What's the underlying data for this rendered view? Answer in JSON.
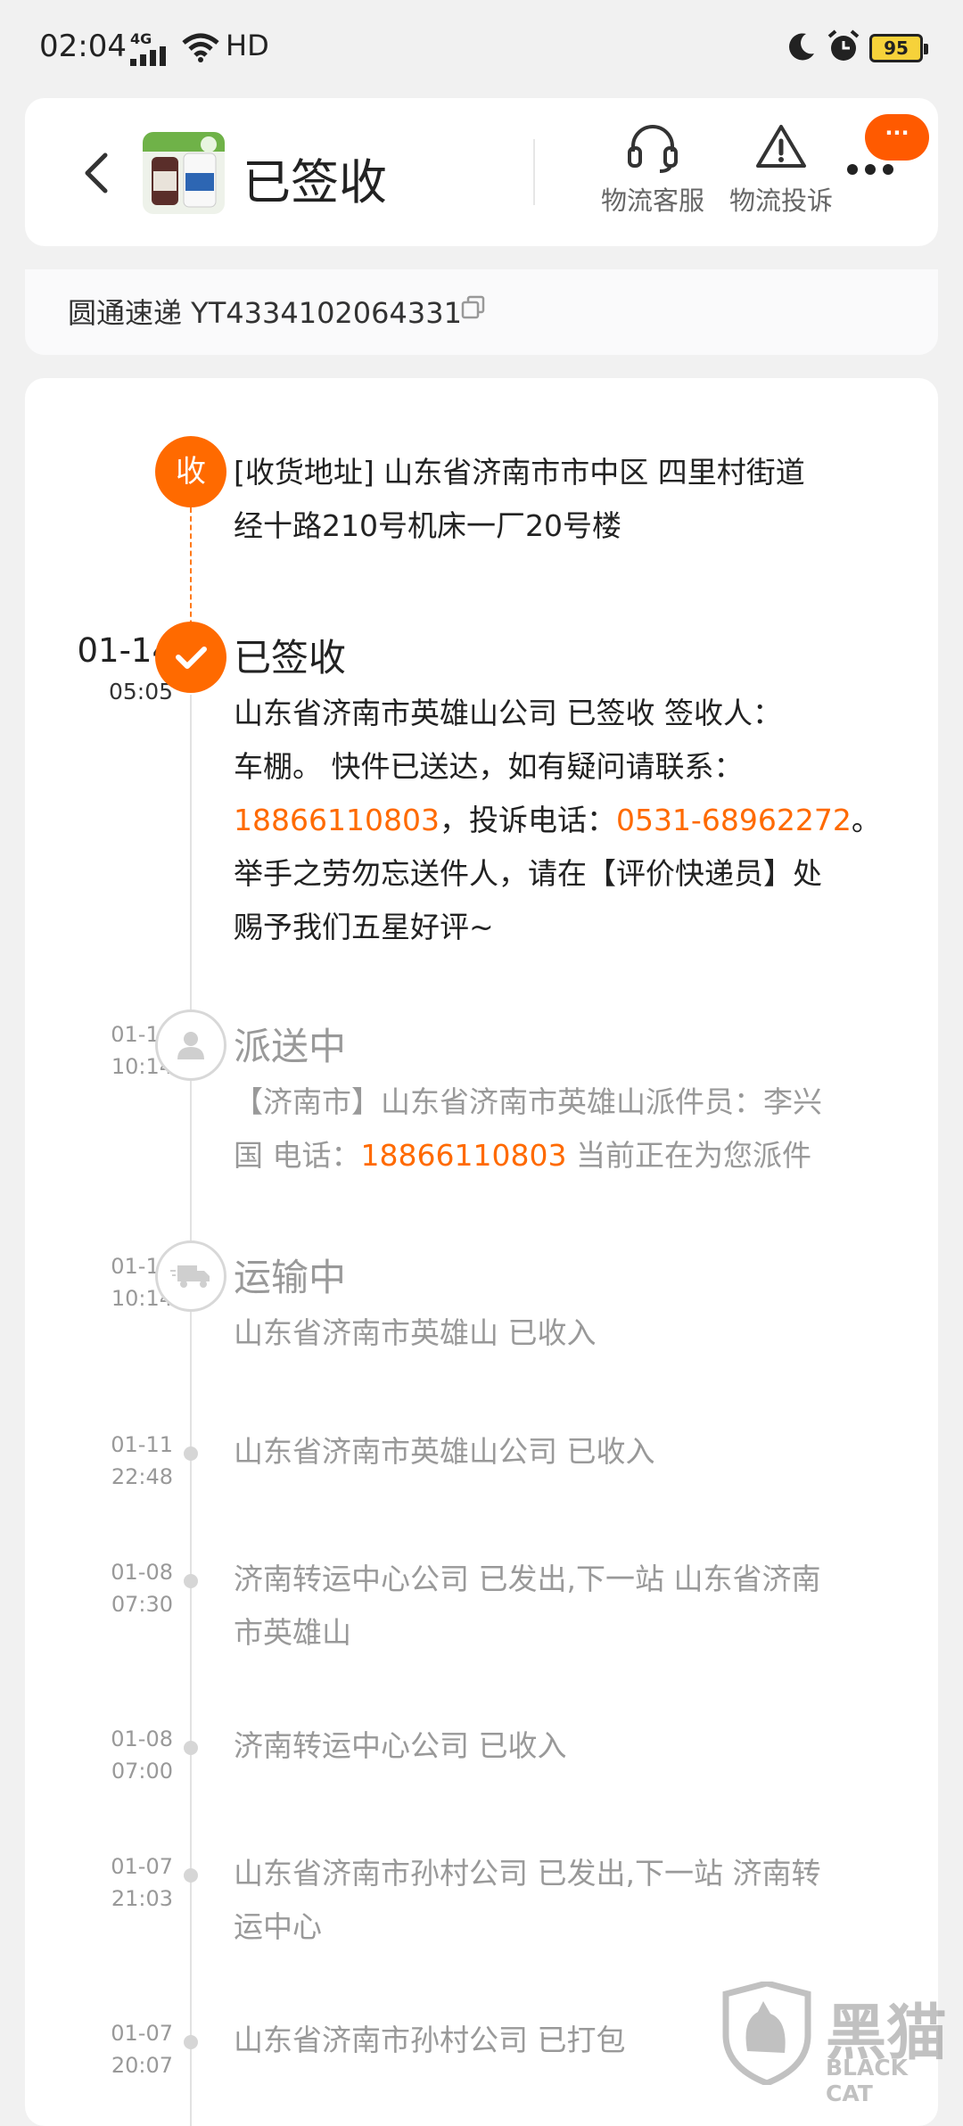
{
  "status_bar": {
    "time": "02:04",
    "network": "4G",
    "hd": "HD",
    "battery": "95"
  },
  "header": {
    "title": "已签收",
    "actions": [
      {
        "label": "物流客服",
        "icon": "headset-icon"
      },
      {
        "label": "物流投诉",
        "icon": "warning-icon"
      }
    ],
    "more_badge": "···"
  },
  "courier": {
    "text": "圆通速递 YT4334102064331"
  },
  "timeline": {
    "address": {
      "badge": "收",
      "line1": "[收货地址] 山东省济南市市中区 四里村街道",
      "line2": "经十路210号机床一厂20号楼"
    },
    "signed": {
      "date": "01-14",
      "time": "05:05",
      "title": "已签收",
      "line1": "山东省济南市英雄山公司 已签收 签收人：",
      "line2": "车棚。 快件已送达，如有疑问请联系：",
      "phone1": "18866110803",
      "mid": "，投诉电话：",
      "phone2": "0531-68962272",
      "end": "。",
      "line4": "举手之劳勿忘送件人，请在【评价快递员】处",
      "line5": "赐予我们五星好评~"
    },
    "delivering": {
      "date": "01-12",
      "time": "10:14",
      "title": "派送中",
      "line1": "【济南市】山东省济南市英雄山派件员：李兴",
      "pre": "国 电话：",
      "phone": "18866110803",
      "post": " 当前正在为您派件"
    },
    "transit": {
      "date": "01-12",
      "time": "10:14",
      "title": "运输中",
      "line1": "山东省济南市英雄山 已收入"
    },
    "events": [
      {
        "date": "01-11",
        "time": "22:48",
        "line1": "山东省济南市英雄山公司 已收入",
        "line2": ""
      },
      {
        "date": "01-08",
        "time": "07:30",
        "line1": "济南转运中心公司 已发出,下一站 山东省济南",
        "line2": "市英雄山"
      },
      {
        "date": "01-08",
        "time": "07:00",
        "line1": "济南转运中心公司 已收入",
        "line2": ""
      },
      {
        "date": "01-07",
        "time": "21:03",
        "line1": "山东省济南市孙村公司 已发出,下一站 济南转",
        "line2": "运中心"
      },
      {
        "date": "01-07",
        "time": "20:07",
        "line1": "山东省济南市孙村公司 已打包",
        "line2": ""
      }
    ]
  },
  "watermark": {
    "word": "黑猫",
    "sub": "BLACK CAT"
  },
  "colors": {
    "accent": "#ff6a00",
    "background": "#f1f1f1"
  }
}
